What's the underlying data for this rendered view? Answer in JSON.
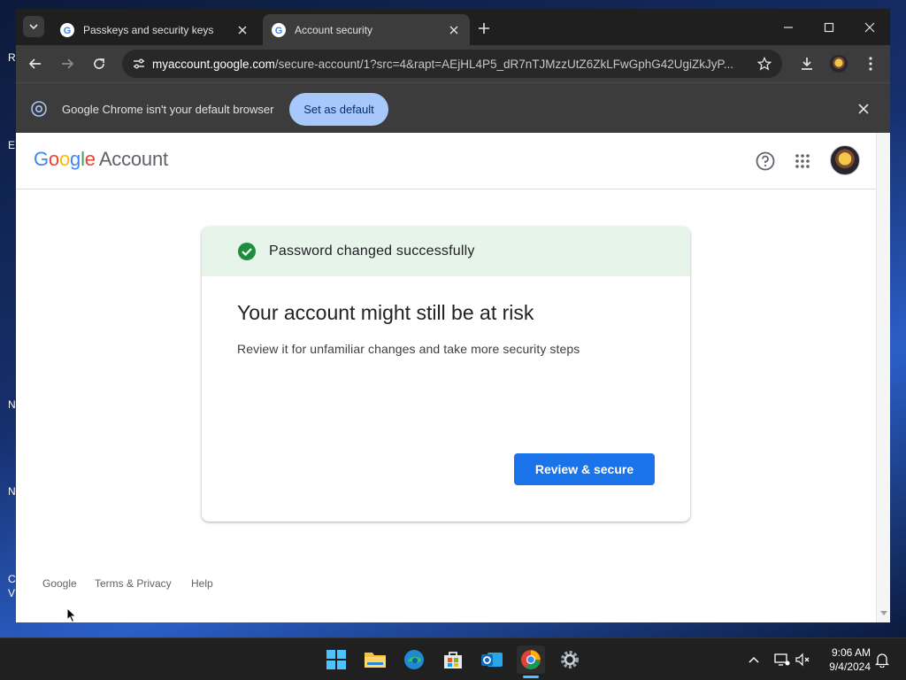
{
  "browser": {
    "tabs": [
      {
        "title": "Passkeys and security keys",
        "active": false
      },
      {
        "title": "Account security",
        "active": true
      }
    ],
    "url": {
      "host": "myaccount.google.com",
      "path": "/secure-account/1?src=4&rapt=AEjHL4P5_dR7nTJMzzUtZ6ZkLFwGphG42UgiZkJyP..."
    },
    "infobar": {
      "message": "Google Chrome isn't your default browser",
      "button_label": "Set as default"
    }
  },
  "page": {
    "logo": {
      "google": "Google",
      "account": "Account"
    },
    "card": {
      "banner_text": "Password changed successfully",
      "title": "Your account might still be at risk",
      "subtitle": "Review it for unfamiliar changes and take more security steps",
      "button_label": "Review & secure"
    },
    "footer": {
      "google": "Google",
      "terms": "Terms & Privacy",
      "help": "Help"
    }
  },
  "taskbar": {
    "time": "9:06 AM",
    "date": "9/4/2024"
  },
  "desktop": {
    "icon_labels": [
      "R",
      "E",
      "N",
      "N",
      "C",
      "V"
    ]
  },
  "colors": {
    "accent_blue": "#1a73e8",
    "success_green": "#1e8e3e",
    "banner_bg": "#e6f4ea",
    "infobar_button": "#a8c7fa"
  },
  "icons": {
    "help": "help-circle-icon",
    "apps": "apps-grid-icon",
    "check": "check-circle-icon"
  }
}
